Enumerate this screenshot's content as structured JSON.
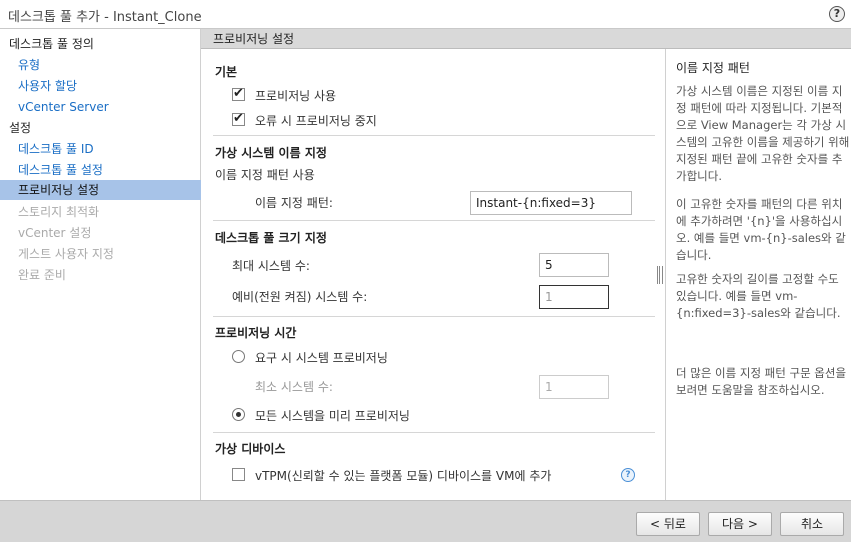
{
  "window": {
    "title": "데스크톱 풀 추가 - Instant_Clone",
    "help_button": "?"
  },
  "nav": {
    "section1": "데스크톱 풀 정의",
    "item_type": "유형",
    "item_user_assignment": "사용자 할당",
    "item_vcenter_server": "vCenter Server",
    "section2": "설정",
    "item_pool_id": "데스크톱 풀 ID",
    "item_pool_settings": "데스크톱 풀 설정",
    "item_provisioning": "프로비저닝 설정",
    "item_storage": "스토리지 최적화",
    "item_vcenter_settings": "vCenter 설정",
    "item_guest": "게스트 사용자 지정",
    "item_ready": "완료 준비"
  },
  "content": {
    "header": "프로비저닝 설정",
    "basic": {
      "title": "기본",
      "enable_provisioning": {
        "label": "프로비저닝 사용",
        "checked": true
      },
      "stop_on_error": {
        "label": "오류 시 프로비저닝 중지",
        "checked": true
      }
    },
    "naming": {
      "title": "가상 시스템 이름 지정",
      "use_pattern": "이름 지정 패턴 사용",
      "pattern_label": "이름 지정 패턴:",
      "pattern_value": "Instant-{n:fixed=3}"
    },
    "pool_size": {
      "title": "데스크톱 풀 크기 지정",
      "max_label": "최대 시스템 수:",
      "max_value": "5",
      "spare_label": "예비(전원 켜짐) 시스템 수:",
      "spare_value": "1"
    },
    "timing": {
      "title": "프로비저닝 시간",
      "on_demand": {
        "label": "요구 시 시스템 프로비저닝",
        "checked": false
      },
      "min_label": "최소 시스템 수:",
      "min_value": "1",
      "up_front": {
        "label": "모든 시스템을 미리 프로비저닝",
        "checked": true
      }
    },
    "devices": {
      "title": "가상 디바이스",
      "vtpm": {
        "label": "vTPM(신뢰할 수 있는 플랫폼 모듈) 디바이스를 VM에 추가",
        "checked": false
      },
      "help_icon": "?"
    }
  },
  "help": {
    "title": "이름 지정 패턴",
    "p1": "가상 시스템 이름은 지정된 이름 지정 패턴에 따라 지정됩니다. 기본적으로 View Manager는 각 가상 시스템의 고유한 이름을 제공하기 위해 지정된 패턴 끝에 고유한 숫자를 추가합니다.",
    "p2": "이 고유한 숫자를 패턴의 다른 위치에 추가하려면 '{n}'을 사용하십시오. 예를 들면 vm-{n}-sales와 같습니다.",
    "p3": "고유한 숫자의 길이를 고정할 수도 있습니다. 예를 들면 vm-{n:fixed=3}-sales와 같습니다.",
    "p4": "더 많은 이름 지정 패턴 구문 옵션을 보려면 도움말을 참조하십시오."
  },
  "footer": {
    "back": "< 뒤로",
    "next": "다음 >",
    "cancel": "취소"
  }
}
